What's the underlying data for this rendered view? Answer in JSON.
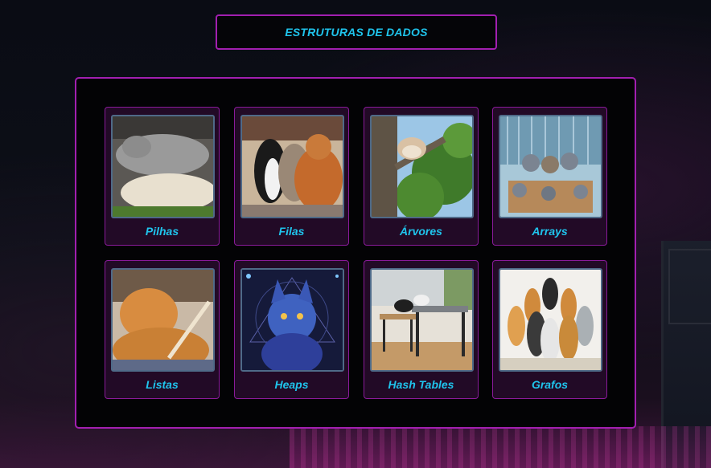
{
  "header": {
    "title": "ESTRUTURAS DE DADOS"
  },
  "cards": [
    {
      "label": "Pilhas",
      "image": "stacked-cats-image"
    },
    {
      "label": "Filas",
      "image": "queued-cats-image"
    },
    {
      "label": "Árvores",
      "image": "cat-in-tree-image"
    },
    {
      "label": "Arrays",
      "image": "cats-in-boxes-image"
    },
    {
      "label": "Listas",
      "image": "orange-cat-image"
    },
    {
      "label": "Heaps",
      "image": "blue-crystal-cat-image"
    },
    {
      "label": "Hash Tables",
      "image": "cats-on-tables-image"
    },
    {
      "label": "Grafos",
      "image": "grid-cats-image"
    }
  ],
  "colors": {
    "accent_border": "#a21fb0",
    "label_text": "#1fc4ec",
    "card_bg": "#220a26"
  }
}
